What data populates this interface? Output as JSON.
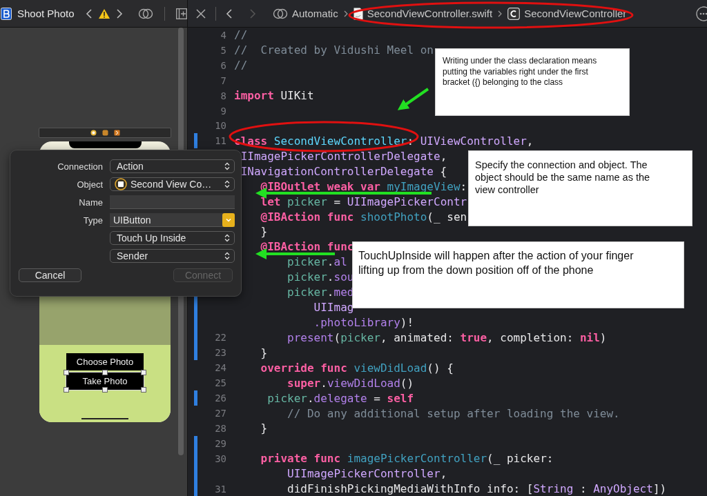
{
  "storyboard_toolbar": {
    "title": "Shoot Photo"
  },
  "editor_toolbar": {
    "forward_disabled": true,
    "mode": "Automatic",
    "file": "SecondViewController.swift",
    "symbol": "SecondViewController"
  },
  "scene": {
    "buttons": [
      {
        "label": "Choose Photo",
        "selected": false
      },
      {
        "label": "Take Photo",
        "selected": true
      }
    ]
  },
  "connection_popup": {
    "fields": [
      {
        "label": "Connection",
        "kind": "popup",
        "value": "Action"
      },
      {
        "label": "Object",
        "kind": "object",
        "value": "Second View Co…"
      },
      {
        "label": "Name",
        "kind": "text"
      },
      {
        "label": "Type",
        "kind": "combo",
        "value": "UIButton"
      },
      {
        "kind": "popup",
        "value": "Touch Up Inside"
      },
      {
        "kind": "popup",
        "value": "Sender"
      }
    ],
    "buttons": [
      {
        "label": "Cancel",
        "disabled": false
      },
      {
        "label": "Connect",
        "disabled": true
      }
    ]
  },
  "code": {
    "lines": [
      {
        "number": "4",
        "changed": false,
        "tokens": [
          {
            "kind": "comment",
            "text": "//"
          }
        ]
      },
      {
        "number": "5",
        "changed": false,
        "tokens": [
          {
            "kind": "comment",
            "text": "//  Created by Vidushi Meel on"
          }
        ]
      },
      {
        "number": "6",
        "changed": false,
        "tokens": [
          {
            "kind": "comment",
            "text": "//"
          }
        ]
      },
      {
        "number": "7",
        "changed": false
      },
      {
        "number": "8",
        "changed": false,
        "tokens": [
          {
            "kind": "keyword",
            "text": "import "
          },
          {
            "kind": "plain",
            "text": "UIKit"
          }
        ]
      },
      {
        "number": "9",
        "changed": false
      },
      {
        "number": "10",
        "changed": false
      },
      {
        "number": "11",
        "changed": true,
        "tokens": [
          {
            "kind": "keyword",
            "text": "class "
          },
          {
            "kind": "own_type",
            "text": "SecondViewController"
          },
          {
            "kind": "plain",
            "text": ": "
          },
          {
            "kind": "type",
            "text": "UIViewController"
          },
          {
            "kind": "plain",
            "text": ","
          }
        ]
      },
      {
        "changed": false,
        "tokens": [
          {
            "kind": "type",
            "text": " IImagePickerControllerDelegate"
          },
          {
            "kind": "plain",
            "text": ","
          }
        ]
      },
      {
        "changed": false,
        "tokens": [
          {
            "kind": "type",
            "text": " INavigationControllerDelegate"
          },
          {
            "kind": "plain",
            "text": " {"
          }
        ]
      },
      {
        "changed": false,
        "tokens": [
          {
            "kind": "keyword",
            "text": "    @IBOutlet weak var "
          },
          {
            "kind": "decl",
            "text": "myImageView"
          },
          {
            "kind": "plain",
            "text": ":"
          }
        ]
      },
      {
        "changed": false,
        "tokens": [
          {
            "kind": "keyword",
            "text": "    let "
          },
          {
            "kind": "prop",
            "text": "picker"
          },
          {
            "kind": "plain",
            "text": " = "
          },
          {
            "kind": "type",
            "text": "UIImagePickerContr"
          }
        ]
      },
      {
        "changed": false,
        "tokens": [
          {
            "kind": "keyword",
            "text": "    @IBAction func "
          },
          {
            "kind": "decl",
            "text": "shootPhoto"
          },
          {
            "kind": "plain",
            "text": "(_ sen"
          }
        ]
      },
      {
        "changed": false,
        "tokens": [
          {
            "kind": "plain",
            "text": "    }"
          }
        ]
      },
      {
        "changed": false,
        "tokens": [
          {
            "kind": "keyword",
            "text": "    @IBAction func"
          }
        ]
      },
      {
        "changed": false,
        "tokens": [
          {
            "kind": "prop",
            "text": "        picker"
          },
          {
            "kind": "plain",
            "text": "."
          },
          {
            "kind": "method",
            "text": "al"
          }
        ]
      },
      {
        "changed": false,
        "tokens": [
          {
            "kind": "prop",
            "text": "        picker"
          },
          {
            "kind": "plain",
            "text": "."
          },
          {
            "kind": "method",
            "text": "sou"
          }
        ]
      },
      {
        "changed": true,
        "tokens": [
          {
            "kind": "prop",
            "text": "        picker"
          },
          {
            "kind": "plain",
            "text": "."
          },
          {
            "kind": "method",
            "text": "med"
          }
        ]
      },
      {
        "changed": true,
        "tokens": [
          {
            "kind": "type",
            "text": "            UIImag"
          }
        ]
      },
      {
        "changed": true,
        "tokens": [
          {
            "kind": "method",
            "text": "            .photoLibrary"
          },
          {
            "kind": "plain",
            "text": ")!"
          }
        ]
      },
      {
        "number": "22",
        "changed": true,
        "tokens": [
          {
            "kind": "method",
            "text": "        present"
          },
          {
            "kind": "plain",
            "text": "("
          },
          {
            "kind": "prop",
            "text": "picker"
          },
          {
            "kind": "plain",
            "text": ", animated: "
          },
          {
            "kind": "keyword",
            "text": "true"
          },
          {
            "kind": "plain",
            "text": ", completion: "
          },
          {
            "kind": "keyword",
            "text": "nil"
          },
          {
            "kind": "plain",
            "text": ")"
          }
        ]
      },
      {
        "number": "23",
        "changed": true,
        "tokens": [
          {
            "kind": "plain",
            "text": "    }"
          }
        ]
      },
      {
        "number": "24",
        "changed": false,
        "tokens": [
          {
            "kind": "keyword",
            "text": "    override func "
          },
          {
            "kind": "decl",
            "text": "viewDidLoad"
          },
          {
            "kind": "plain",
            "text": "() {"
          }
        ]
      },
      {
        "number": "25",
        "changed": false,
        "tokens": [
          {
            "kind": "keyword",
            "text": "        super"
          },
          {
            "kind": "plain",
            "text": "."
          },
          {
            "kind": "method",
            "text": "viewDidLoad"
          },
          {
            "kind": "plain",
            "text": "()"
          }
        ]
      },
      {
        "number": "26",
        "changed": true,
        "tokens": [
          {
            "kind": "prop",
            "text": "     picker"
          },
          {
            "kind": "plain",
            "text": "."
          },
          {
            "kind": "method",
            "text": "delegate"
          },
          {
            "kind": "plain",
            "text": " = "
          },
          {
            "kind": "keyword",
            "text": "self"
          }
        ]
      },
      {
        "number": "27",
        "changed": false,
        "tokens": [
          {
            "kind": "comment",
            "text": "        // Do any additional setup after loading the view."
          }
        ]
      },
      {
        "number": "28",
        "changed": false,
        "tokens": [
          {
            "kind": "plain",
            "text": "    }"
          }
        ]
      },
      {
        "number": "29",
        "changed": true
      },
      {
        "number": "30",
        "changed": true,
        "tokens": [
          {
            "kind": "keyword",
            "text": "    private func "
          },
          {
            "kind": "decl",
            "text": "imagePickerController"
          },
          {
            "kind": "plain",
            "text": "(_ picker:"
          }
        ]
      },
      {
        "changed": true,
        "tokens": [
          {
            "kind": "type",
            "text": "        UIImagePickerController"
          },
          {
            "kind": "plain",
            "text": ","
          }
        ]
      },
      {
        "number": "31",
        "changed": true,
        "tokens": [
          {
            "kind": "plain",
            "text": "        didFinishPickingMediaWithInfo info: ["
          },
          {
            "kind": "type",
            "text": "String"
          },
          {
            "kind": "plain",
            "text": " : "
          },
          {
            "kind": "type",
            "text": "AnyObject"
          },
          {
            "kind": "plain",
            "text": "])"
          }
        ]
      }
    ]
  },
  "callouts": [
    {
      "text": "Writing under the class declaration means putting the variables right under the first bracket ({) belonging to the class"
    },
    {
      "text": "Specify the connection and object. The object should be the same name as the view controller"
    },
    {
      "text": "TouchUpInside will happen after the action of your finger lifting up from the down position off of the phone"
    }
  ]
}
